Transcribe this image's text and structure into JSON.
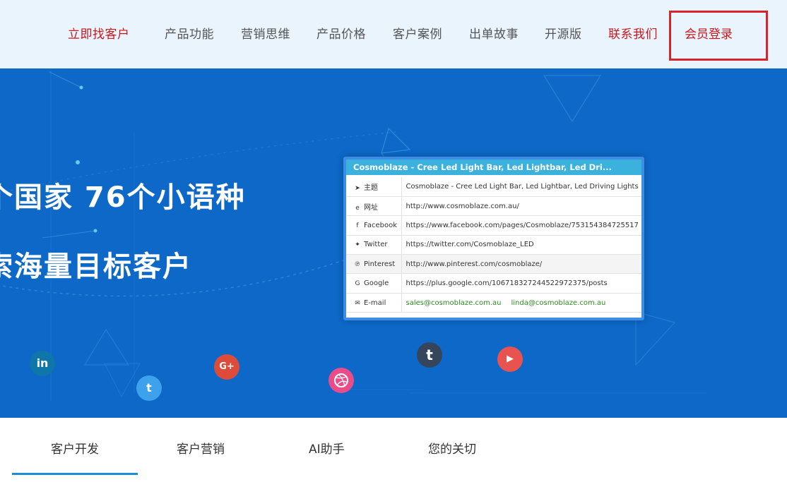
{
  "nav": {
    "items": [
      {
        "label": "立即找客户"
      },
      {
        "label": "产品功能"
      },
      {
        "label": "营销思维"
      },
      {
        "label": "产品价格"
      },
      {
        "label": "客户案例"
      },
      {
        "label": "出单故事"
      },
      {
        "label": "开源版"
      },
      {
        "label": "联系我们"
      },
      {
        "label": "会员登录"
      }
    ]
  },
  "hero": {
    "headline_line1": "个国家  76个小语种",
    "headline_line2": "索海量目标客户",
    "card": {
      "title": "Cosmoblaze - Cree Led Light Bar, Led Lightbar, Led Dri...",
      "rows": [
        {
          "icon": "send-icon",
          "label": "主题",
          "value": "Cosmoblaze - Cree Led Light Bar, Led Lightbar, Led Driving Lights"
        },
        {
          "icon": "ie-icon",
          "label": "网址",
          "value": "http://www.cosmoblaze.com.au/"
        },
        {
          "icon": "facebook-icon",
          "label": "Facebook",
          "value": "https://www.facebook.com/pages/Cosmoblaze/753154384725517"
        },
        {
          "icon": "twitter-icon",
          "label": "Twitter",
          "value": "https://twitter.com/Cosmoblaze_LED"
        },
        {
          "icon": "pinterest-icon",
          "label": "Pinterest",
          "value": "http://www.pinterest.com/cosmoblaze/"
        },
        {
          "icon": "google-plus-icon",
          "label": "Google",
          "value": "https://plus.google.com/106718327244522972375/posts"
        },
        {
          "icon": "email-icon",
          "label": "E-mail",
          "value": "sales@cosmoblaze.com.au",
          "value2": "linda@cosmoblaze.com.au"
        }
      ]
    },
    "social": {
      "linkedin": "in",
      "twitter": "t",
      "google": "G+",
      "tumblr": "t",
      "youtube": "▶"
    }
  },
  "tabs": [
    {
      "label": "客户开发"
    },
    {
      "label": "客户营销"
    },
    {
      "label": "AI助手"
    },
    {
      "label": "您的关切"
    }
  ],
  "colors": {
    "nav_bg": "#eaf4fc",
    "hero_bg": "#0d68c7",
    "accent_red": "#c8161d",
    "tab_underline": "#1a8fd5"
  }
}
